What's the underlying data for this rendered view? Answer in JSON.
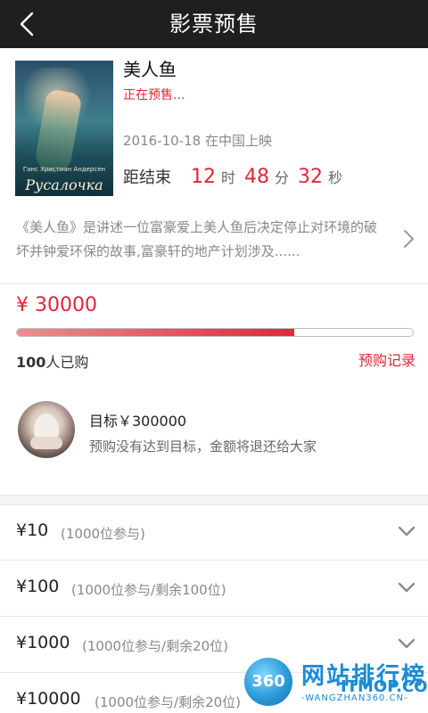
{
  "header": {
    "title": "影票预售"
  },
  "movie": {
    "name": "美人鱼",
    "status": "正在预售...",
    "release": "2016-10-18 在中国上映",
    "countdown_label": "距结束",
    "hours": "12",
    "hours_unit": "时",
    "minutes": "48",
    "minutes_unit": "分",
    "seconds": "32",
    "seconds_unit": "秒",
    "description": "《美人鱼》是讲述一位富豪爱上美人鱼后决定停止对环境的破坏并钟爱环保的故事,富豪轩的地产计划涉及......",
    "poster": {
      "author": "Ганс Христиан Андерсен",
      "title": "Русалочка"
    }
  },
  "funding": {
    "price": "¥ 30000",
    "progress_fraction": 0.7,
    "bought_count": "100",
    "bought_suffix": "人已购",
    "records_link": "预购记录"
  },
  "goal": {
    "target": "目标￥300000",
    "refund_note": "预购没有达到目标，金额将退还给大家"
  },
  "tiers": [
    {
      "amount": "¥10",
      "detail": "(1000位参与)"
    },
    {
      "amount": "¥100",
      "detail": "(1000位参与/剩余100位)"
    },
    {
      "amount": "¥1000",
      "detail": "(1000位参与/剩余20位)"
    },
    {
      "amount": "¥10000",
      "detail": "(1000位参与/剩余20位)"
    }
  ],
  "watermark": {
    "badge": "360",
    "name": "网站排行榜",
    "logo": "ITMOP.COM",
    "url": "-WANGZHAN360.CN-"
  },
  "colors": {
    "accent": "#e2263a",
    "header_bg": "#1f1f1f"
  }
}
